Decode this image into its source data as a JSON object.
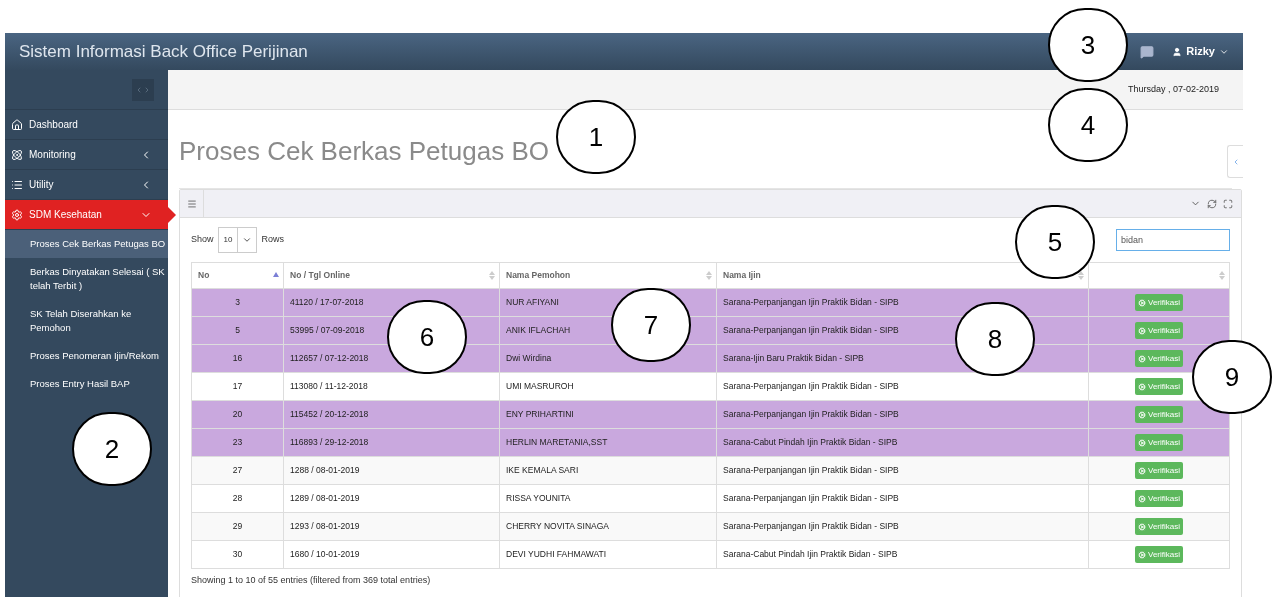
{
  "header": {
    "title": "Sistem Informasi Back Office Perijinan",
    "user": "Rizky"
  },
  "sidebar": {
    "items": [
      {
        "label": "Dashboard",
        "selected": false
      },
      {
        "label": "Monitoring",
        "selected": false,
        "expanded": false
      },
      {
        "label": "Utility",
        "selected": false,
        "expanded": false
      },
      {
        "label": "SDM Kesehatan",
        "selected": true,
        "expanded": true,
        "children": [
          {
            "label": "Proses Cek Berkas Petugas BO",
            "selected": true
          },
          {
            "label": "Berkas Dinyatakan Selesai ( SK telah Terbit )",
            "selected": false
          },
          {
            "label": "SK Telah Diserahkan ke Pemohon",
            "selected": false
          },
          {
            "label": "Proses Penomeran Ijin/Rekom",
            "selected": false
          },
          {
            "label": "Proses Entry Hasil BAP",
            "selected": false
          }
        ]
      }
    ]
  },
  "date": "Thursday , 07-02-2019",
  "page_title": "Proses Cek Berkas Petugas BO",
  "table_controls": {
    "show_label": "Show",
    "page_size": "10",
    "rows_label": "Rows",
    "search_value": "bidan"
  },
  "table": {
    "columns": [
      {
        "label": "No",
        "sorted": true
      },
      {
        "label": "No / Tgl Online",
        "sorted": false
      },
      {
        "label": "Nama Pemohon",
        "sorted": false
      },
      {
        "label": "Nama Ijin",
        "sorted": false
      },
      {
        "sorted": false
      }
    ],
    "rows": [
      {
        "no": "3",
        "online": "41120 / 17-07-2018",
        "pemohon": "NUR AFIYANI",
        "ijin": "Sarana-Perpanjangan Ijin Praktik Bidan - SIPB",
        "action": "Verifikasi",
        "highlighted": true
      },
      {
        "no": "5",
        "online": "53995 / 07-09-2018",
        "pemohon": "ANIK IFLACHAH",
        "ijin": "Sarana-Perpanjangan Ijin Praktik Bidan - SIPB",
        "action": "Verifikasi",
        "highlighted": true
      },
      {
        "no": "16",
        "online": "112657 / 07-12-2018",
        "pemohon": "Dwi Wirdina",
        "ijin": "Sarana-Ijin Baru Praktik Bidan - SIPB",
        "action": "Verifikasi",
        "highlighted": true
      },
      {
        "no": "17",
        "online": "113080 / 11-12-2018",
        "pemohon": "UMI MASRUROH",
        "ijin": "Sarana-Perpanjangan Ijin Praktik Bidan - SIPB",
        "action": "Verifikasi",
        "highlighted": false
      },
      {
        "no": "20",
        "online": "115452 / 20-12-2018",
        "pemohon": "ENY PRIHARTINI",
        "ijin": "Sarana-Perpanjangan Ijin Praktik Bidan - SIPB",
        "action": "Verifikasi",
        "highlighted": true
      },
      {
        "no": "23",
        "online": "116893 / 29-12-2018",
        "pemohon": "HERLIN MARETANIA,SST",
        "ijin": "Sarana-Cabut Pindah Ijin Praktik Bidan - SIPB",
        "action": "Verifikasi",
        "highlighted": true
      },
      {
        "no": "27",
        "online": "1288 / 08-01-2019",
        "pemohon": "IKE KEMALA SARI",
        "ijin": "Sarana-Perpanjangan Ijin Praktik Bidan - SIPB",
        "action": "Verifikasi",
        "highlighted": false
      },
      {
        "no": "28",
        "online": "1289 / 08-01-2019",
        "pemohon": "RISSA YOUNITA",
        "ijin": "Sarana-Perpanjangan Ijin Praktik Bidan - SIPB",
        "action": "Verifikasi",
        "highlighted": false
      },
      {
        "no": "29",
        "online": "1293 / 08-01-2019",
        "pemohon": "CHERRY NOVITA SINAGA",
        "ijin": "Sarana-Perpanjangan Ijin Praktik Bidan - SIPB",
        "action": "Verifikasi",
        "highlighted": false
      },
      {
        "no": "30",
        "online": "1680 / 10-01-2019",
        "pemohon": "DEVI YUDHI FAHMAWATI",
        "ijin": "Sarana-Cabut Pindah Ijin Praktik Bidan - SIPB",
        "action": "Verifikasi",
        "highlighted": false
      }
    ]
  },
  "footer": "Showing 1 to 10 of 55 entries (filtered from 369 total entries)",
  "callouts": [
    "1",
    "2",
    "3",
    "4",
    "5",
    "6",
    "7",
    "8",
    "9"
  ]
}
